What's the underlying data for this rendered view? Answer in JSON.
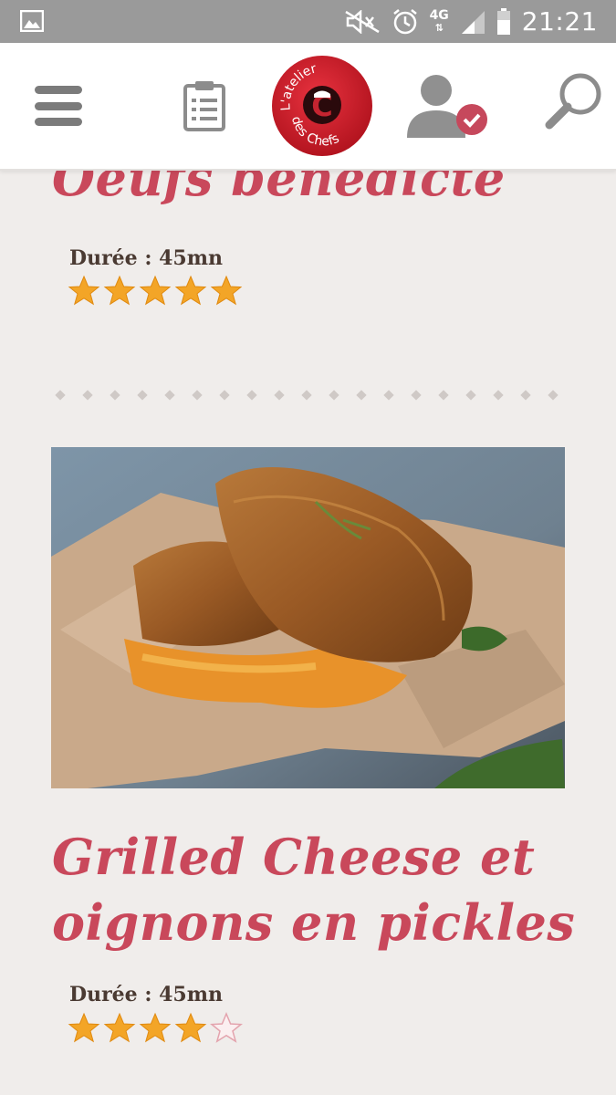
{
  "status_bar": {
    "time": "21:21",
    "network": "4G",
    "icons": [
      "gallery-icon",
      "mute-icon",
      "alarm-icon",
      "signal-icon",
      "battery-icon"
    ]
  },
  "header": {
    "logo_text_top": "L'atelier",
    "logo_text_bottom": "des Chefs",
    "logo_letter": "C",
    "icons": [
      "menu-icon",
      "clipboard-icon",
      "user-verified-icon",
      "search-icon"
    ]
  },
  "recipes": [
    {
      "title": "Oeufs bénédicte",
      "duration": "Durée : 45mn",
      "rating": 5
    },
    {
      "title": "Grilled Cheese et oignons en pickles",
      "duration": "Durée : 45mn",
      "rating": 4
    }
  ],
  "colors": {
    "accent": "#c9485b",
    "status_bar": "#9a9a9a",
    "background": "#f0edeb",
    "star": "#f3a527",
    "logo_red": "#d01f2c"
  }
}
